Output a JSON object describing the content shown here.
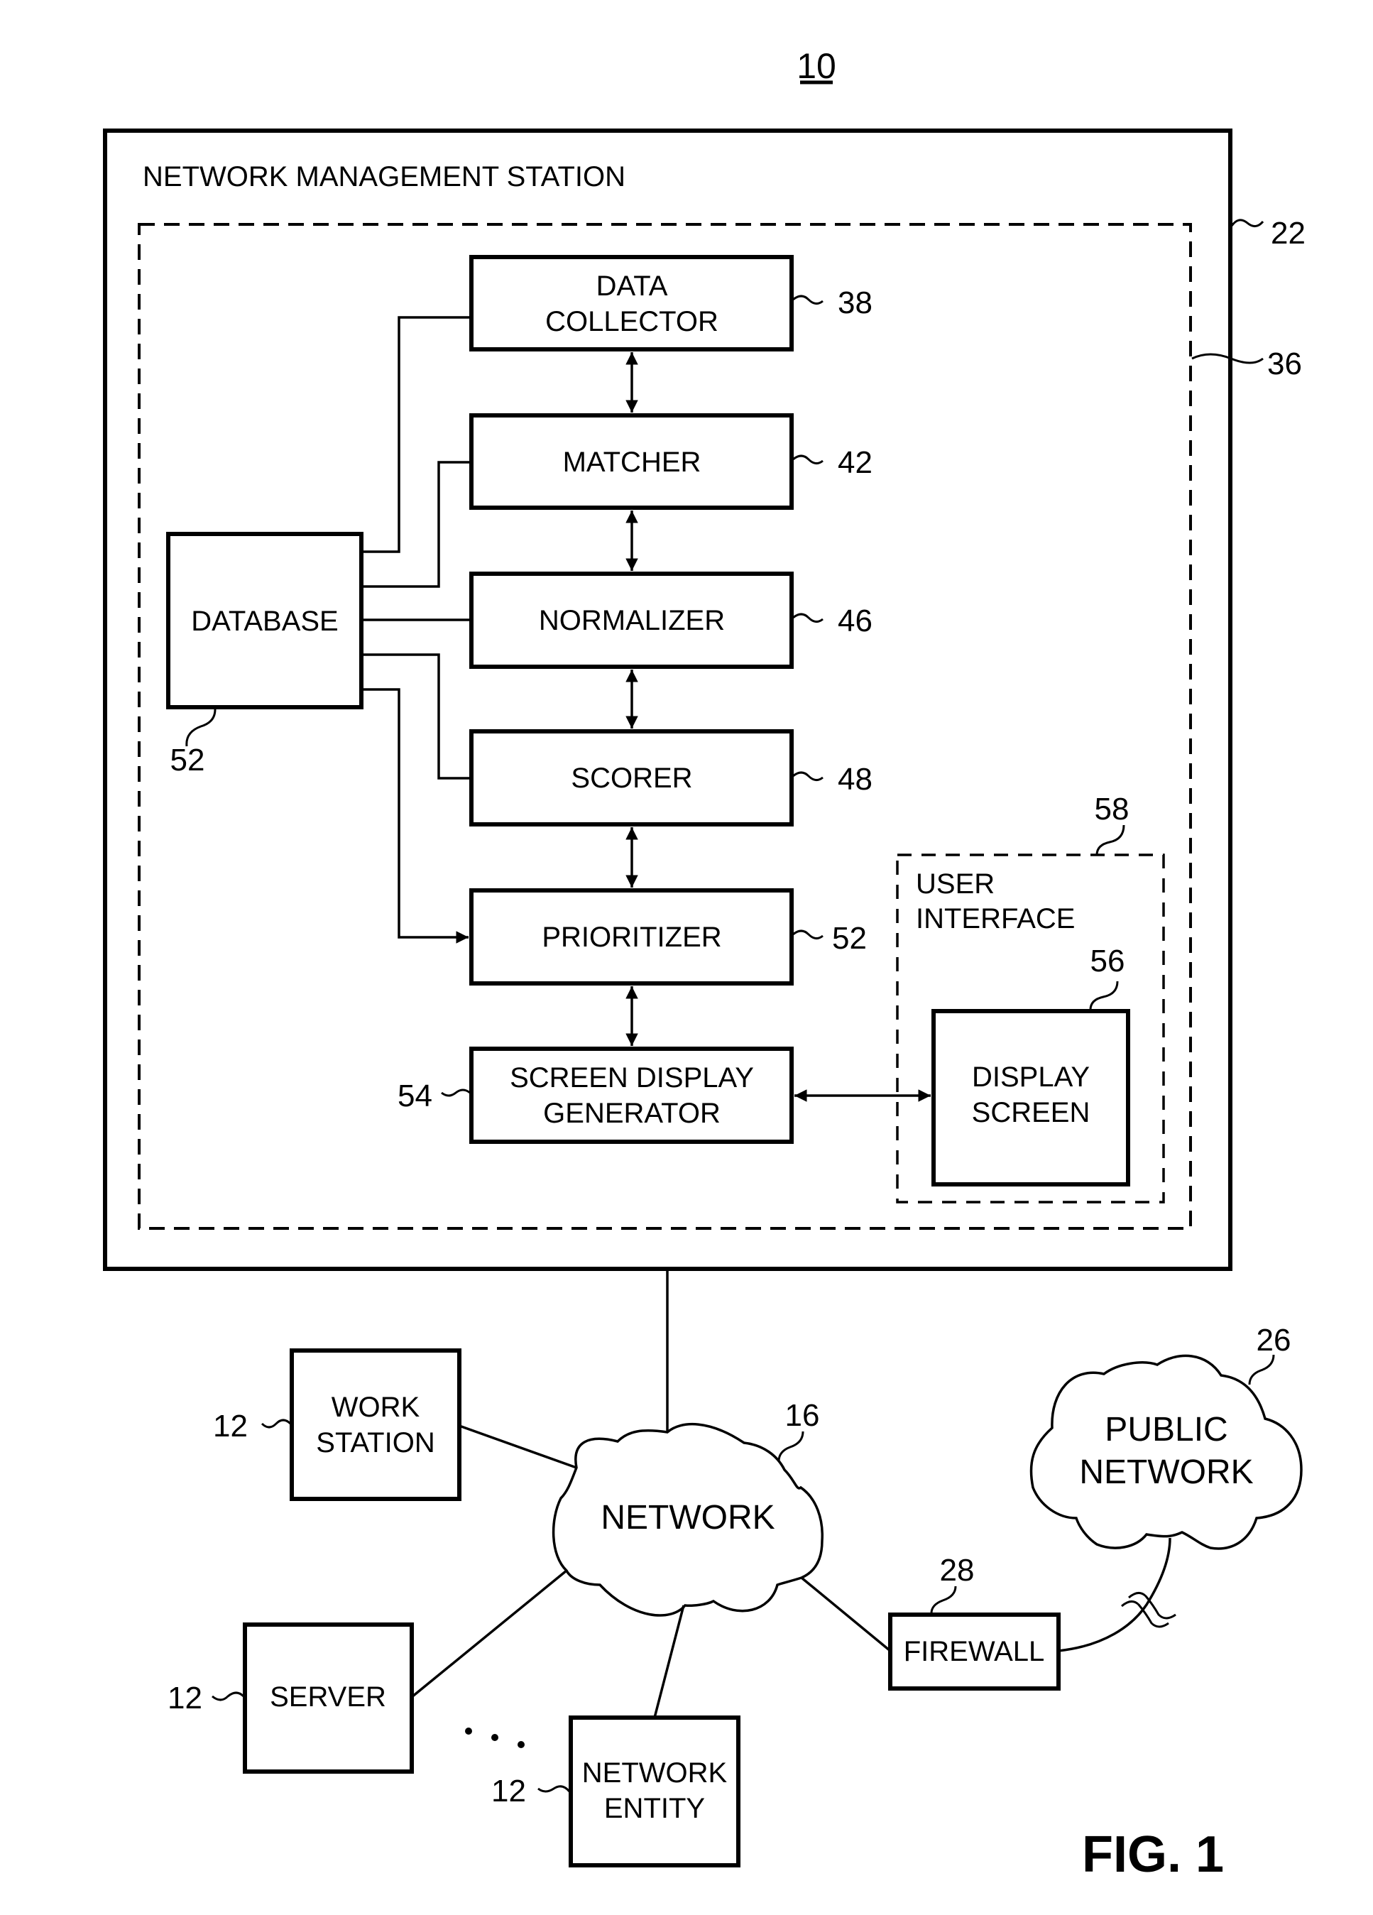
{
  "figure": {
    "number_label": "10",
    "caption": "FIG. 1"
  },
  "station": {
    "title": "NETWORK MANAGEMENT STATION",
    "ref": "22",
    "inner_ref": "36"
  },
  "modules": [
    {
      "lines": [
        "DATA",
        "COLLECTOR"
      ],
      "ref": "38"
    },
    {
      "lines": [
        "MATCHER"
      ],
      "ref": "42"
    },
    {
      "lines": [
        "NORMALIZER"
      ],
      "ref": "46"
    },
    {
      "lines": [
        "SCORER"
      ],
      "ref": "48"
    },
    {
      "lines": [
        "PRIORITIZER"
      ],
      "ref": "52"
    },
    {
      "lines": [
        "SCREEN DISPLAY",
        "GENERATOR"
      ],
      "ref": "54"
    }
  ],
  "database": {
    "label": "DATABASE",
    "ref": "52"
  },
  "user_interface": {
    "lines": [
      "USER",
      "INTERFACE"
    ],
    "ref": "58",
    "display": {
      "lines": [
        "DISPLAY",
        "SCREEN"
      ],
      "ref": "56"
    }
  },
  "network": {
    "label": "NETWORK",
    "ref": "16"
  },
  "public_network": {
    "lines": [
      "PUBLIC",
      "NETWORK"
    ],
    "ref": "26"
  },
  "firewall": {
    "label": "FIREWALL",
    "ref": "28"
  },
  "entities": [
    {
      "lines": [
        "WORK",
        "STATION"
      ],
      "ref": "12"
    },
    {
      "lines": [
        "SERVER"
      ],
      "ref": "12"
    },
    {
      "lines": [
        "NETWORK",
        "ENTITY"
      ],
      "ref": "12"
    }
  ],
  "ellipsis": "..."
}
